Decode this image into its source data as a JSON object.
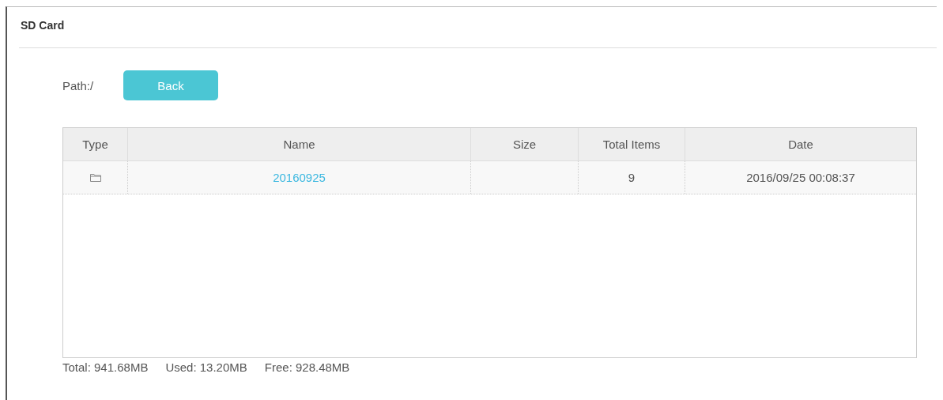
{
  "panel": {
    "title": "SD Card"
  },
  "path": {
    "label": "Path:/"
  },
  "back_button": {
    "label": "Back"
  },
  "table": {
    "columns": [
      "Type",
      "Name",
      "Size",
      "Total Items",
      "Date"
    ],
    "rows": [
      {
        "kind": "folder",
        "name": "20160925",
        "size": "",
        "total_items": "9",
        "date": "2016/09/25 00:08:37"
      }
    ]
  },
  "footer": [
    {
      "label": "Total: 941.68MB"
    },
    {
      "label": "Used: 13.20MB"
    },
    {
      "label": "Free: 928.48MB"
    }
  ]
}
